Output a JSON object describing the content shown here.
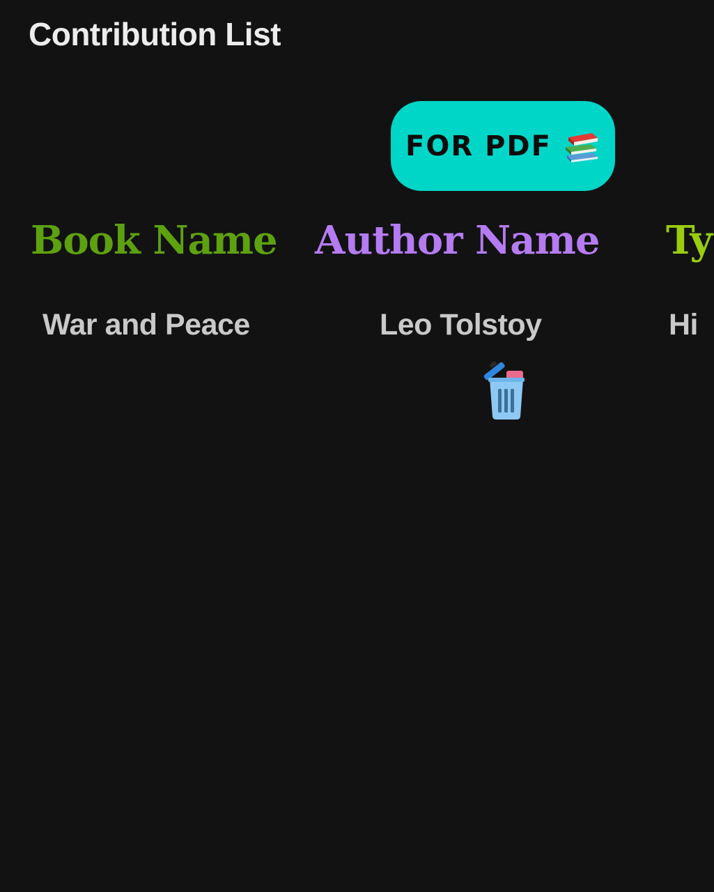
{
  "page": {
    "title": "Contribution List"
  },
  "actions": {
    "pdf_label": "FOR PDF",
    "pdf_icon": "books-icon",
    "pdf_color": "#00d6c8"
  },
  "table": {
    "headers": [
      {
        "label": "Book Name",
        "color": "#5ea10f"
      },
      {
        "label": "Author Name",
        "color": "#b57bf2"
      },
      {
        "label": "Ty",
        "color": "#9acd0d"
      }
    ],
    "rows": [
      {
        "book": "War and Peace",
        "author": "Leo Tolstoy",
        "type": "Hi",
        "delete_icon": "trash-icon"
      }
    ]
  }
}
